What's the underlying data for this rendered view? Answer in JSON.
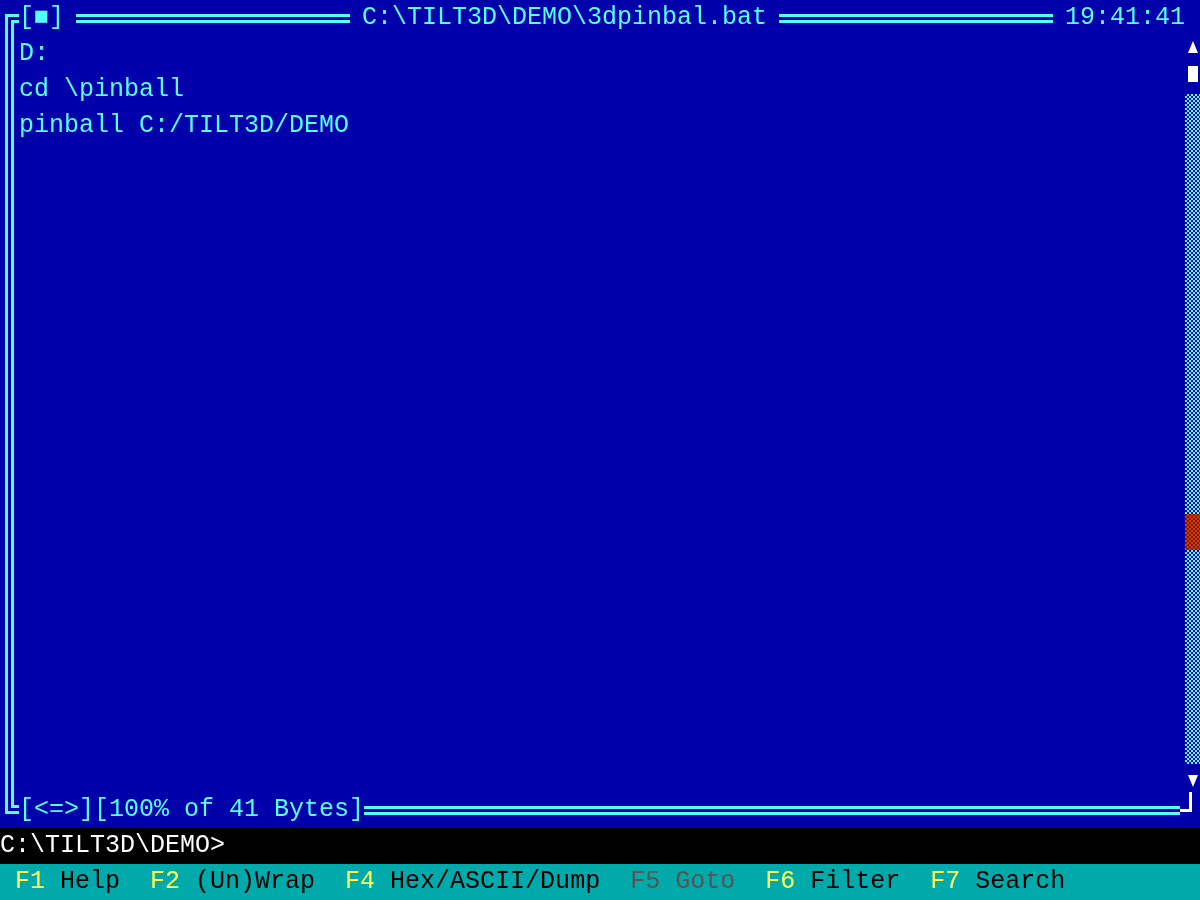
{
  "window": {
    "title": "C:\\TILT3D\\DEMO\\3dpinbal.bat",
    "close_box": "[■]",
    "clock": "19:41:41"
  },
  "lines": [
    "D:",
    "cd \\pinball",
    "pinball C:/TILT3D/DEMO"
  ],
  "status": {
    "wrap": "[<=>]",
    "position": "[100% of 41 Bytes]"
  },
  "prompt": "C:\\TILT3D\\DEMO>",
  "function_keys": [
    {
      "key": "F1",
      "label": "Help",
      "disabled": false
    },
    {
      "key": "F2",
      "label": "(Un)Wrap",
      "disabled": false
    },
    {
      "key": "F4",
      "label": "Hex/ASCII/Dump",
      "disabled": false
    },
    {
      "key": "F5",
      "label": "Goto",
      "disabled": true
    },
    {
      "key": "F6",
      "label": "Filter",
      "disabled": false
    },
    {
      "key": "F7",
      "label": "Search",
      "disabled": false
    }
  ]
}
